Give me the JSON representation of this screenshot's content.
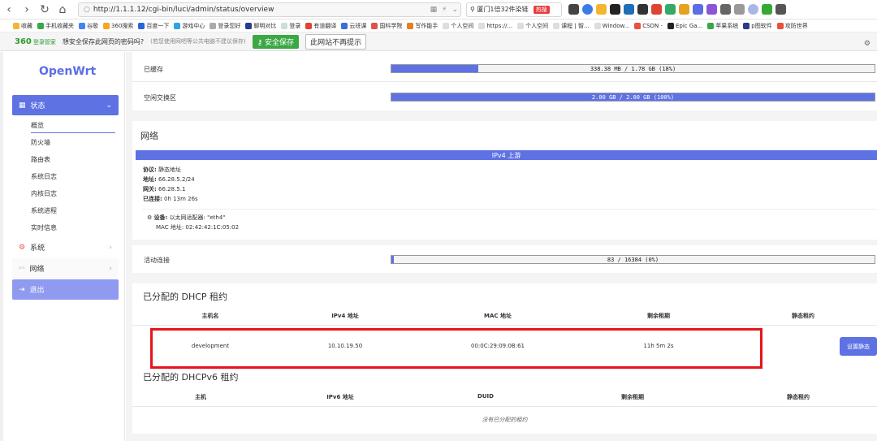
{
  "browser": {
    "url": "http://1.1.1.12/cgi-bin/luci/admin/status/overview",
    "search_text": "厦门1倍32件染链",
    "hot_label": "热搜",
    "bookmarks": [
      "收藏",
      "手机收藏夹",
      "谷歌",
      "360搜索",
      "百度一下",
      "游戏中心",
      "登录您好",
      "聊明对比",
      "登录",
      "有道翻译",
      "云班课",
      "国科学院",
      "写作能手",
      "个人空间",
      "https://...",
      "个人空间",
      "课程 | 智...",
      "Window...",
      "CSDN -",
      "Epic Ga...",
      "苹果系统",
      "p图软件",
      "攻防世界"
    ],
    "password_bar": {
      "brand": "360",
      "brand_sub": "登录管家",
      "question": "想安全保存此网页的密码吗?",
      "hint": "(若您使用网吧等公共电脑不建议保存)",
      "save_label": "安全保存",
      "never_label": "此网站不再提示"
    }
  },
  "sidebar": {
    "logo": "OpenWrt",
    "status_label": "状态",
    "sub_items": [
      "概览",
      "防火墙",
      "路由表",
      "系统日志",
      "内核日志",
      "系统进程",
      "实时信息"
    ],
    "system_label": "系统",
    "network_label": "网络",
    "logout_label": "退出"
  },
  "memory": {
    "cached_label": "已缓存",
    "cached_value": "338.38 MB / 1.78 GB (18%)",
    "cached_fraction": 0.18,
    "free_swap_label": "空闲交换区",
    "free_swap_value": "2.00 GB / 2.00 GB (100%)",
    "free_swap_fraction": 1.0
  },
  "network": {
    "title": "网络",
    "ipv4_title": "IPv4 上游",
    "protocol_label": "协议:",
    "protocol_value": "静态地址",
    "address_label": "地址:",
    "address_value": "66.28.5.2/24",
    "gateway_label": "网关:",
    "gateway_value": "66.28.5.1",
    "connected_label": "已连接:",
    "connected_value": "0h 13m 26s",
    "device_label": "设备:",
    "device_value": "以太网适配器: \"eth4\"",
    "mac_label": "MAC 地址:",
    "mac_value": "02:42:42:1C:05:02"
  },
  "connections": {
    "label": "活动连接",
    "value": "83 / 16384 (0%)",
    "fraction": 0.005
  },
  "dhcp": {
    "title": "已分配的 DHCP 租约",
    "headers": [
      "主机名",
      "IPv4 地址",
      "MAC 地址",
      "剩余租期",
      "静态租约"
    ],
    "rows": [
      {
        "host": "development",
        "ip": "10.10.19.50",
        "mac": "00:0C:29:09:0B:61",
        "lease": "11h 5m 2s",
        "action": "设置静态"
      }
    ]
  },
  "dhcpv6": {
    "title": "已分配的 DHCPv6 租约",
    "headers": [
      "主机",
      "IPv6 地址",
      "DUID",
      "剩余租期",
      "静态租约"
    ],
    "empty_text": "没有已分配的租约"
  },
  "colors": {
    "accent": "#5e72e4",
    "highlight": "#e6141b",
    "save_green": "#39a845"
  }
}
